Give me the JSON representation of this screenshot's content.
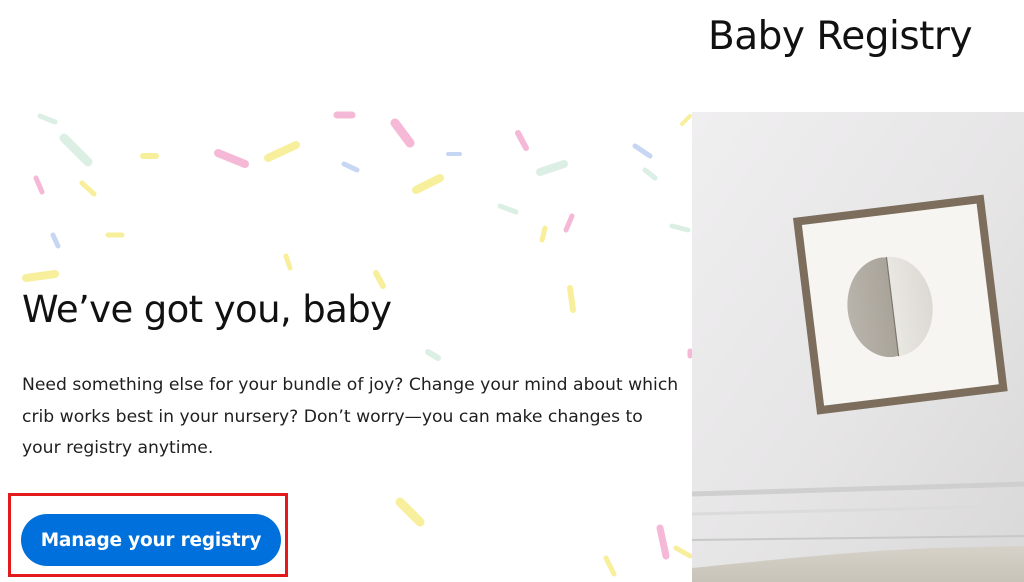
{
  "page": {
    "title": "Baby Registry"
  },
  "hero": {
    "heading": "We’ve got you, baby",
    "body": "Need something else for your bundle of joy? Change your mind about which crib works best in your nursery? Don’t worry—you can make changes to your registry anytime.",
    "cta_label": "Manage your registry",
    "colors": {
      "cta_background": "#0071dc",
      "highlight_border": "#e31b1b",
      "confetti": [
        "#f5b8d6",
        "#f7ef9b",
        "#dcefe4",
        "#c7d6f2"
      ]
    },
    "image_subject": "nursery-wall-framed-art-photo"
  }
}
